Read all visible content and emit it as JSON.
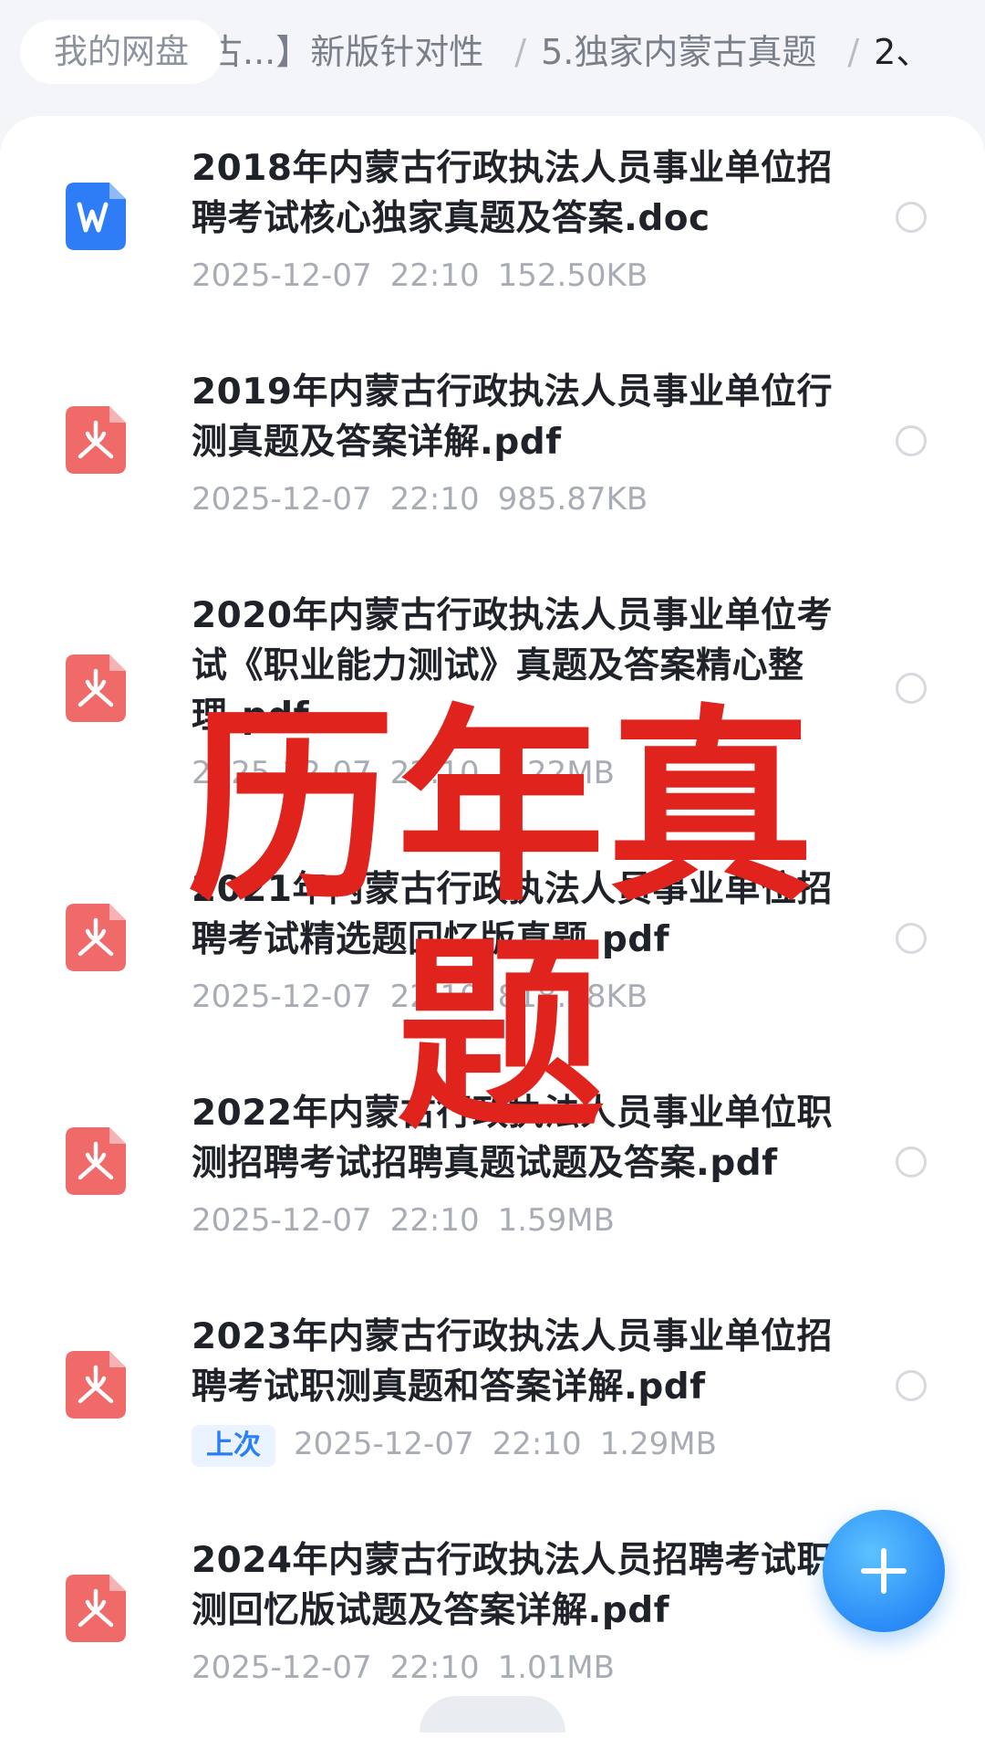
{
  "breadcrumb": {
    "home": "我的网盘",
    "items": [
      "蒙古...】新版针对性",
      "5.独家内蒙古真题",
      "2、"
    ]
  },
  "files": [
    {
      "name": "2018年内蒙古行政执法人员事业单位招聘考试核心独家真题及答案.doc",
      "date": "2025-12-07",
      "time": "22:10",
      "size": "152.50KB",
      "type_icon": "word-doc-icon",
      "badge": ""
    },
    {
      "name": "2019年内蒙古行政执法人员事业单位行测真题及答案详解.pdf",
      "date": "2025-12-07",
      "time": "22:10",
      "size": "985.87KB",
      "type_icon": "pdf-icon",
      "badge": ""
    },
    {
      "name": "2020年内蒙古行政执法人员事业单位考试《职业能力测试》真题及答案精心整理.pdf",
      "date": "2025-12-07",
      "time": "22:10",
      "size": "1.22MB",
      "type_icon": "pdf-icon",
      "badge": ""
    },
    {
      "name": "2021年内蒙古行政执法人员事业单位招聘考试精选题回忆版真题.pdf",
      "date": "2025-12-07",
      "time": "22:10",
      "size": "818.58KB",
      "type_icon": "pdf-icon",
      "badge": ""
    },
    {
      "name": "2022年内蒙古行政执法人员事业单位职测招聘考试招聘真题试题及答案.pdf",
      "date": "2025-12-07",
      "time": "22:10",
      "size": "1.59MB",
      "type_icon": "pdf-icon",
      "badge": ""
    },
    {
      "name": "2023年内蒙古行政执法人员事业单位招聘考试职测真题和答案详解.pdf",
      "date": "2025-12-07",
      "time": "22:10",
      "size": "1.29MB",
      "type_icon": "pdf-icon",
      "badge": "上次"
    },
    {
      "name": "2024年内蒙古行政执法人员招聘考试职测回忆版试题及答案详解.pdf",
      "date": "2025-12-07",
      "time": "22:10",
      "size": "1.01MB",
      "type_icon": "pdf-icon",
      "badge": ""
    }
  ],
  "overlay_text": "历年真题",
  "fab": {
    "icon": "plus-icon"
  },
  "colors": {
    "accent": "#2a8cf7",
    "pdf": "#f06a6a",
    "word": "#2e7df6",
    "overlay": "#e0231c",
    "badge_text": "#2a7ff5"
  }
}
